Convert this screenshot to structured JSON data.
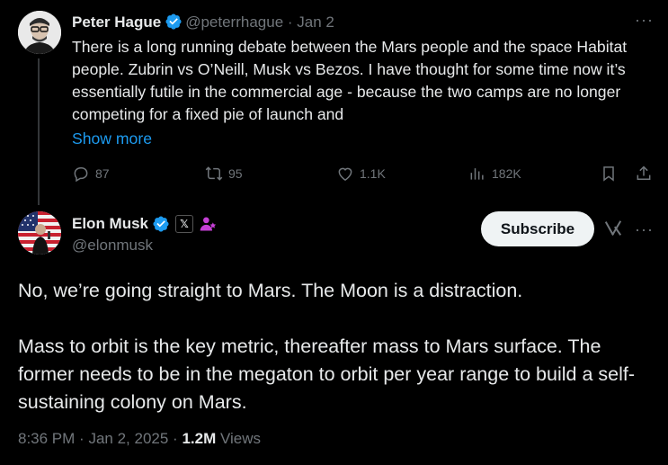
{
  "first_tweet": {
    "author_name": "Peter Hague",
    "handle": "@peterrhague",
    "separator": "·",
    "date": "Jan 2",
    "text": "There is a long running debate between the Mars people and the space Habitat people. Zubrin vs O’Neill, Musk vs Bezos. I have thought for some time now it’s essentially futile in the commercial age - because the two camps are no longer competing for a fixed pie of launch and",
    "show_more_label": "Show more",
    "more_label": "···",
    "stats": {
      "replies": "87",
      "reposts": "95",
      "likes": "1.1K",
      "views": "182K"
    }
  },
  "second_tweet": {
    "author_name": "Elon Musk",
    "handle": "@elonmusk",
    "x_badge": "𝕏",
    "subscribe_label": "Subscribe",
    "more_label": "···",
    "paragraphs": [
      "No, we’re going straight to Mars. The Moon is a distraction.",
      "Mass to orbit is the key metric, thereafter mass to Mars surface. The former needs to be in the megaton to orbit per year range to build a self-sustaining colony on Mars."
    ],
    "time": "8:36 PM",
    "date": "Jan 2, 2025",
    "separator": "·",
    "views_count": "1.2M",
    "views_label": "Views"
  },
  "colors": {
    "background": "#000000",
    "text": "#e7e9ea",
    "muted": "#71767b",
    "link": "#1d9bf0",
    "verified": "#1d9bf0",
    "affiliate": "#c53fd5",
    "subscribe_bg": "#eff3f4"
  }
}
